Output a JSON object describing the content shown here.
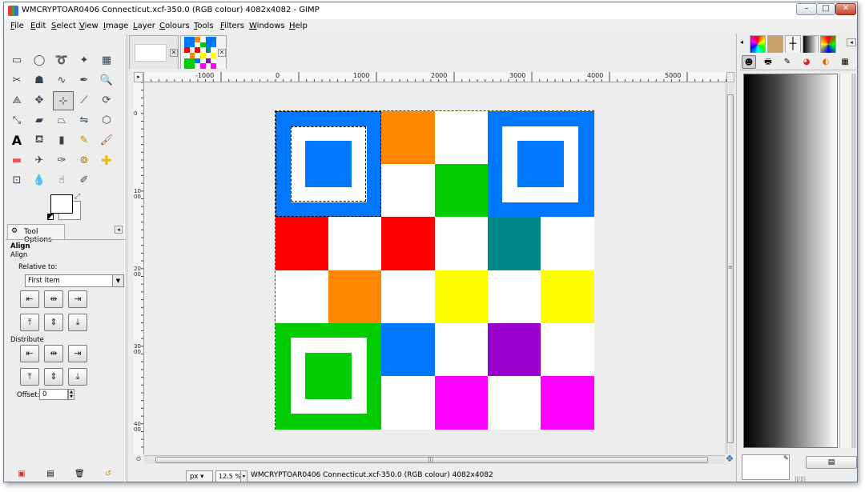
{
  "window": {
    "title": "WMCRYPTOAR0406 Connecticut.xcf-350.0 (RGB colour) 4082x4082 - GIMP",
    "controls": {
      "minimize": "–",
      "maximize": "□",
      "close": "✕"
    }
  },
  "menu": [
    "File",
    "Edit",
    "Select",
    "View",
    "Image",
    "Layer",
    "Colours",
    "Tools",
    "Filters",
    "Windows",
    "Help"
  ],
  "tool_options": {
    "tab_label": "Tool Options",
    "title": "Align",
    "subtitle": "Align",
    "relative_to_label": "Relative to:",
    "relative_to_value": "First item",
    "distribute_label": "Distribute",
    "offset_label": "Offset:",
    "offset_value": "0"
  },
  "align_buttons": [
    "align-left",
    "align-center",
    "align-right",
    "align-top",
    "align-middle",
    "align-bottom"
  ],
  "ruler": {
    "h_labels": [
      "-1000",
      "0",
      "1000",
      "2000",
      "3000",
      "4000",
      "5000"
    ],
    "v_labels": [
      "0",
      "1000",
      "2000",
      "3000",
      "4000"
    ]
  },
  "status": {
    "unit": "px",
    "zoom": "12.5 %",
    "text": "WMCRYPTOAR0406 Connecticut.xcf-350.0 (RGB colour) 4082x4082"
  },
  "board": {
    "rows": [
      [
        "blue",
        "blue",
        "orange",
        "white",
        "blue",
        "blue"
      ],
      [
        "blue",
        "blue",
        "white",
        "green",
        "blue",
        "blue"
      ],
      [
        "red",
        "white",
        "red",
        "white",
        "teal",
        "white"
      ],
      [
        "white",
        "orange",
        "white",
        "yellow",
        "white",
        "yellow"
      ],
      [
        "green",
        "green",
        "blue",
        "white",
        "purple",
        "white"
      ],
      [
        "green",
        "green",
        "white",
        "magenta",
        "white",
        "magenta"
      ]
    ],
    "colors": {
      "blue": "#0077ff",
      "orange": "#ff8800",
      "green": "#00cc00",
      "red": "#ff0000",
      "teal": "#008888",
      "yellow": "#ffff00",
      "purple": "#9900cc",
      "magenta": "#ff00ff",
      "white": "#ffffff"
    }
  },
  "tools": [
    "rect-select-icon",
    "ellipse-select-icon",
    "free-select-icon",
    "fuzzy-select-icon",
    "color-select-icon",
    "scissors-icon",
    "foreground-select-icon",
    "paths-icon",
    "color-picker-icon",
    "zoom-icon",
    "measure-icon",
    "move-icon",
    "align-icon",
    "crop-icon",
    "rotate-icon",
    "scale-icon",
    "shear-icon",
    "perspective-icon",
    "flip-icon",
    "cage-icon",
    "text-icon",
    "bucket-fill-icon",
    "blend-icon",
    "pencil-icon",
    "paintbrush-icon",
    "eraser-icon",
    "airbrush-icon",
    "ink-icon",
    "clone-icon",
    "heal-icon",
    "perspective-clone-icon",
    "blur-icon",
    "smudge-icon",
    "dodge-burn-icon"
  ]
}
